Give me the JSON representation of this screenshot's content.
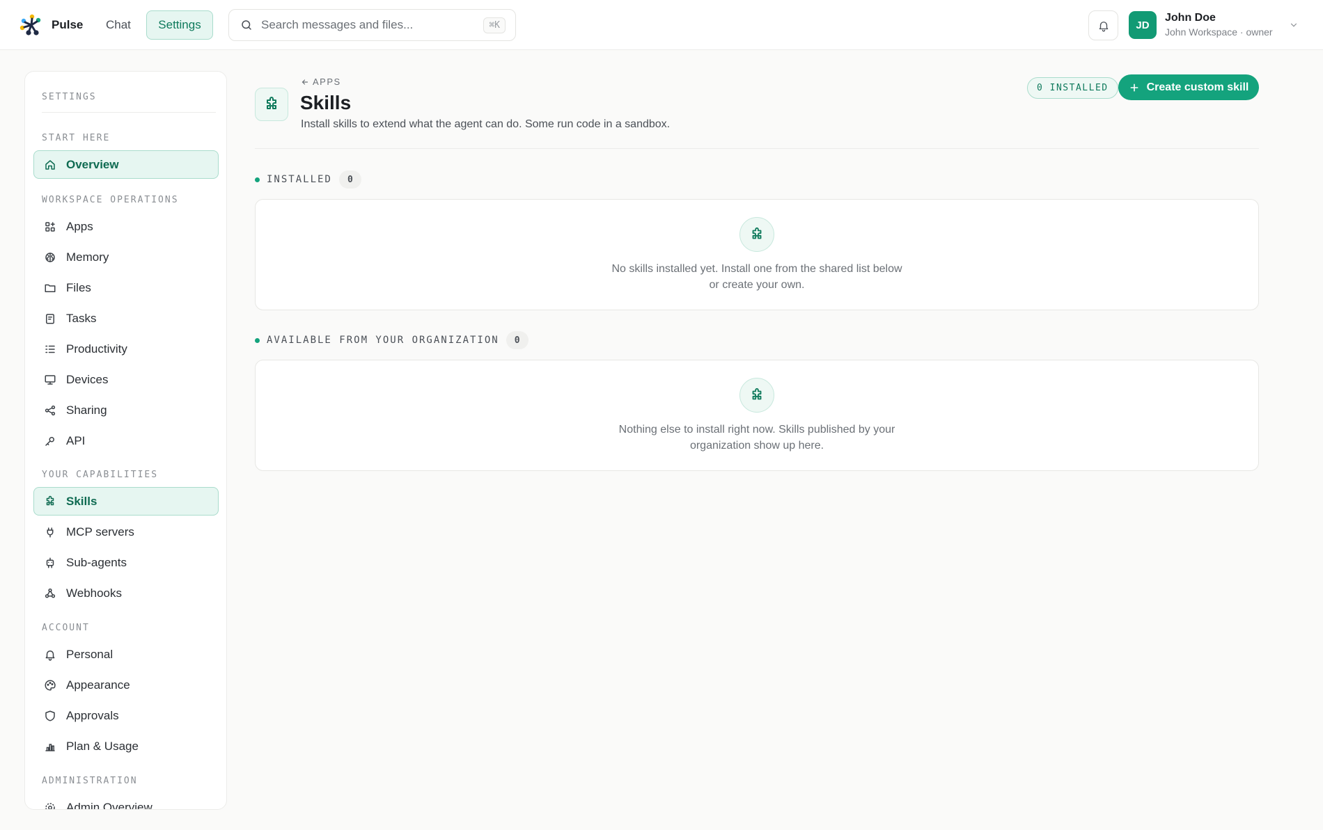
{
  "header": {
    "brand": "Pulse",
    "nav": {
      "chat": "Chat",
      "settings": "Settings"
    },
    "search": {
      "placeholder": "Search messages and files...",
      "shortcut": "⌘K"
    },
    "user": {
      "initials": "JD",
      "name": "John Doe",
      "subtitle": "John Workspace · owner"
    }
  },
  "sidebar": {
    "title": "SETTINGS",
    "sections": {
      "start": "START HERE",
      "workspace": "WORKSPACE OPERATIONS",
      "capabilities": "YOUR CAPABILITIES",
      "account": "ACCOUNT",
      "admin": "ADMINISTRATION"
    },
    "items": {
      "overview": "Overview",
      "apps": "Apps",
      "memory": "Memory",
      "files": "Files",
      "tasks": "Tasks",
      "productivity": "Productivity",
      "devices": "Devices",
      "sharing": "Sharing",
      "api": "API",
      "skills": "Skills",
      "mcp": "MCP servers",
      "subagents": "Sub-agents",
      "webhooks": "Webhooks",
      "personal": "Personal",
      "appearance": "Appearance",
      "approvals": "Approvals",
      "plan": "Plan & Usage",
      "admin_overview": "Admin Overview"
    }
  },
  "main": {
    "back_label": "APPS",
    "title": "Skills",
    "description": "Install skills to extend what the agent can do. Some run code in a sandbox.",
    "installed_badge": "0 INSTALLED",
    "create_button": "Create custom skill",
    "installed": {
      "label": "INSTALLED",
      "count": "0",
      "empty_line1": "No skills installed yet. Install one from the shared list below",
      "empty_line2": "or create your own."
    },
    "available": {
      "label": "AVAILABLE FROM YOUR ORGANIZATION",
      "count": "0",
      "empty_line1": "Nothing else to install right now. Skills published by your",
      "empty_line2": "organization show up here."
    }
  },
  "colors": {
    "accent": "#14a37d",
    "accent_light": "#e6f6f1",
    "accent_border": "#a9dccc"
  }
}
